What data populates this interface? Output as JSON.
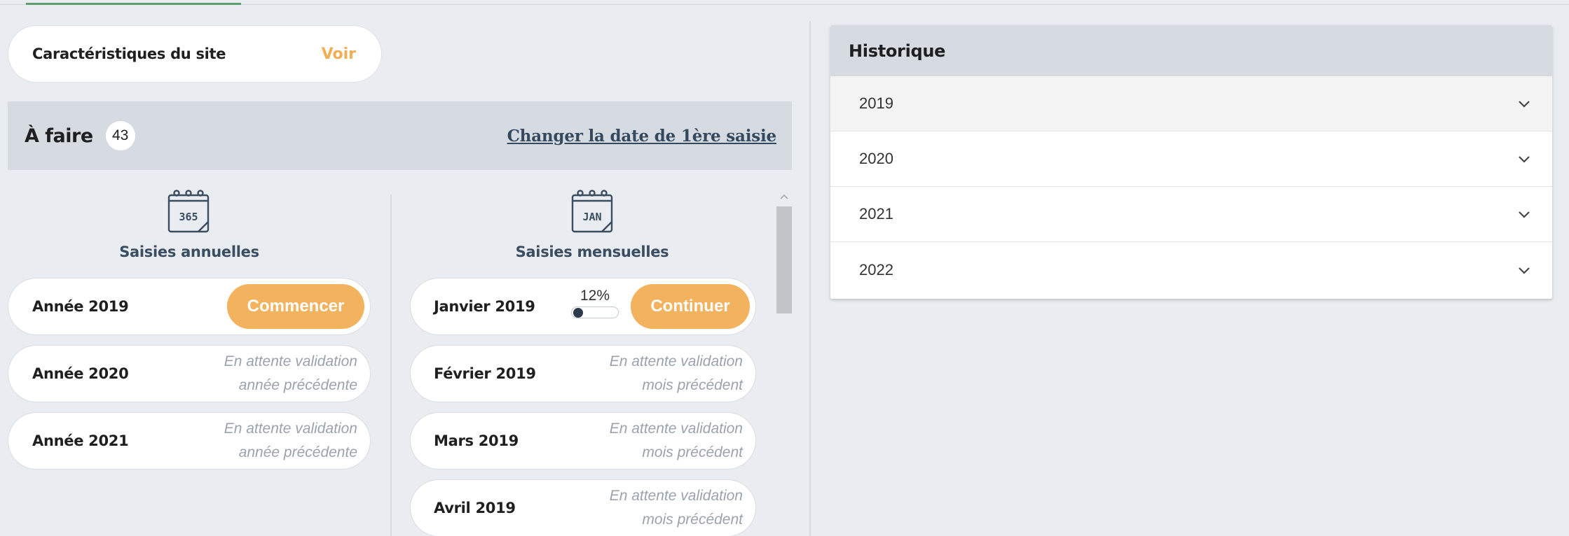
{
  "site": {
    "title": "Caractéristiques du site",
    "action": "Voir"
  },
  "todo": {
    "title": "À faire",
    "count": "43",
    "change_date_link": "Changer la date de 1ère saisie"
  },
  "annual": {
    "icon_text": "365",
    "heading": "Saisies annuelles",
    "items": [
      {
        "label": "Année 2019",
        "button": "Commencer"
      },
      {
        "label": "Année 2020",
        "pending_line1": "En attente validation",
        "pending_line2": "année précédente"
      },
      {
        "label": "Année 2021",
        "pending_line1": "En attente validation",
        "pending_line2": "année précédente"
      }
    ]
  },
  "monthly": {
    "icon_text": "JAN",
    "heading": "Saisies mensuelles",
    "items": [
      {
        "label": "Janvier 2019",
        "progress": "12%",
        "progress_value": 0.12,
        "button": "Continuer"
      },
      {
        "label": "Février 2019",
        "pending_line1": "En attente validation",
        "pending_line2": "mois précédent"
      },
      {
        "label": "Mars 2019",
        "pending_line1": "En attente validation",
        "pending_line2": "mois précédent"
      },
      {
        "label": "Avril 2019",
        "pending_line1": "En attente validation",
        "pending_line2": "mois précédent"
      }
    ]
  },
  "history": {
    "title": "Historique",
    "years": [
      "2019",
      "2020",
      "2021",
      "2022"
    ]
  },
  "colors": {
    "accent": "#f2b25e",
    "link": "#34495e",
    "panel_header": "#d6dbe2",
    "background": "#e9ecf0"
  },
  "icons": {
    "annual": "calendar-365-icon",
    "monthly": "calendar-jan-icon",
    "expand": "chevron-down-icon",
    "scroll_up": "scroll-up-arrow-icon"
  }
}
